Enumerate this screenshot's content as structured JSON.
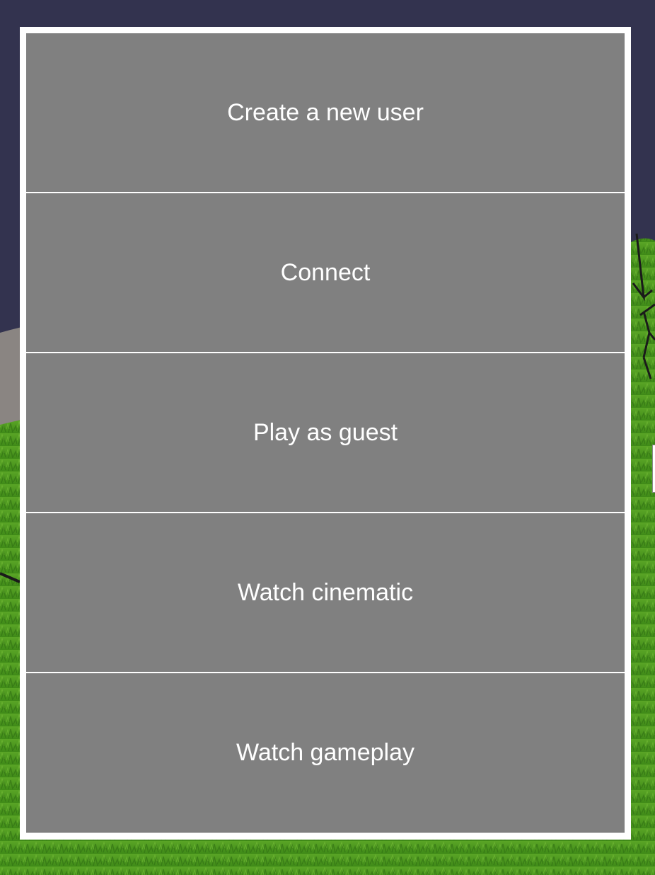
{
  "colors": {
    "sky": "#33334f",
    "grass": "#4f9a1f",
    "grass_dark": "#3a7a16",
    "menu_button_bg": "#808080",
    "menu_frame": "#ffffff",
    "menu_text": "#ffffff"
  },
  "menu": {
    "items": [
      {
        "label": "Create a new user",
        "name": "create-user-button"
      },
      {
        "label": "Connect",
        "name": "connect-button"
      },
      {
        "label": "Play as guest",
        "name": "play-as-guest-button"
      },
      {
        "label": "Watch cinematic",
        "name": "watch-cinematic-button"
      },
      {
        "label": "Watch gameplay",
        "name": "watch-gameplay-button"
      }
    ]
  }
}
